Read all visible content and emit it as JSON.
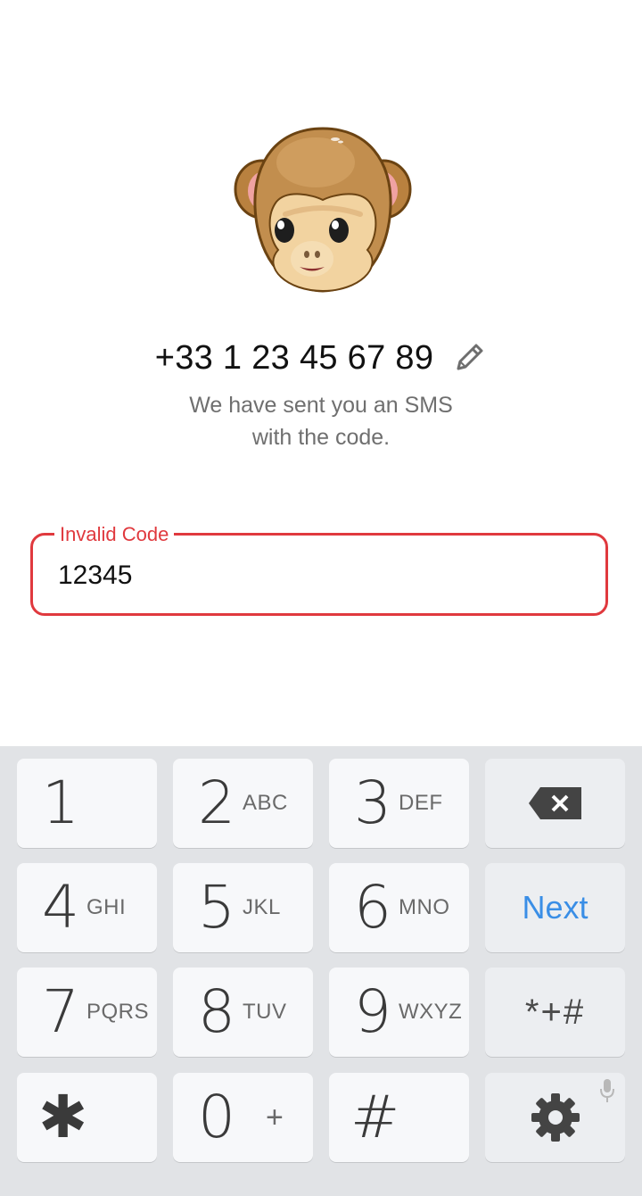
{
  "phone": {
    "number": "+33 1 23 45 67 89",
    "edit_icon": "pencil-icon"
  },
  "message": {
    "line1": "We have sent you an SMS",
    "line2": "with the code."
  },
  "code_input": {
    "label": "Invalid Code",
    "value": "12345",
    "state": "error"
  },
  "keyboard": {
    "keys": [
      {
        "digit": "1",
        "letters": ""
      },
      {
        "digit": "2",
        "letters": "ABC"
      },
      {
        "digit": "3",
        "letters": "DEF"
      },
      {
        "digit": "4",
        "letters": "GHI"
      },
      {
        "digit": "5",
        "letters": "JKL"
      },
      {
        "digit": "6",
        "letters": "MNO"
      },
      {
        "digit": "7",
        "letters": "PQRS"
      },
      {
        "digit": "8",
        "letters": "TUV"
      },
      {
        "digit": "9",
        "letters": "WXYZ"
      },
      {
        "digit": "✱",
        "letters": ""
      },
      {
        "digit": "0",
        "letters": "+"
      },
      {
        "digit": "#",
        "letters": ""
      }
    ],
    "next_label": "Next",
    "symbols_label": "*+#",
    "backspace_icon": "backspace-icon",
    "settings_icon": "gear-icon",
    "mic_icon": "mic-icon"
  },
  "colors": {
    "error": "#e0393e",
    "accent": "#3a8ee6",
    "keyboard_bg": "#e1e3e6"
  }
}
